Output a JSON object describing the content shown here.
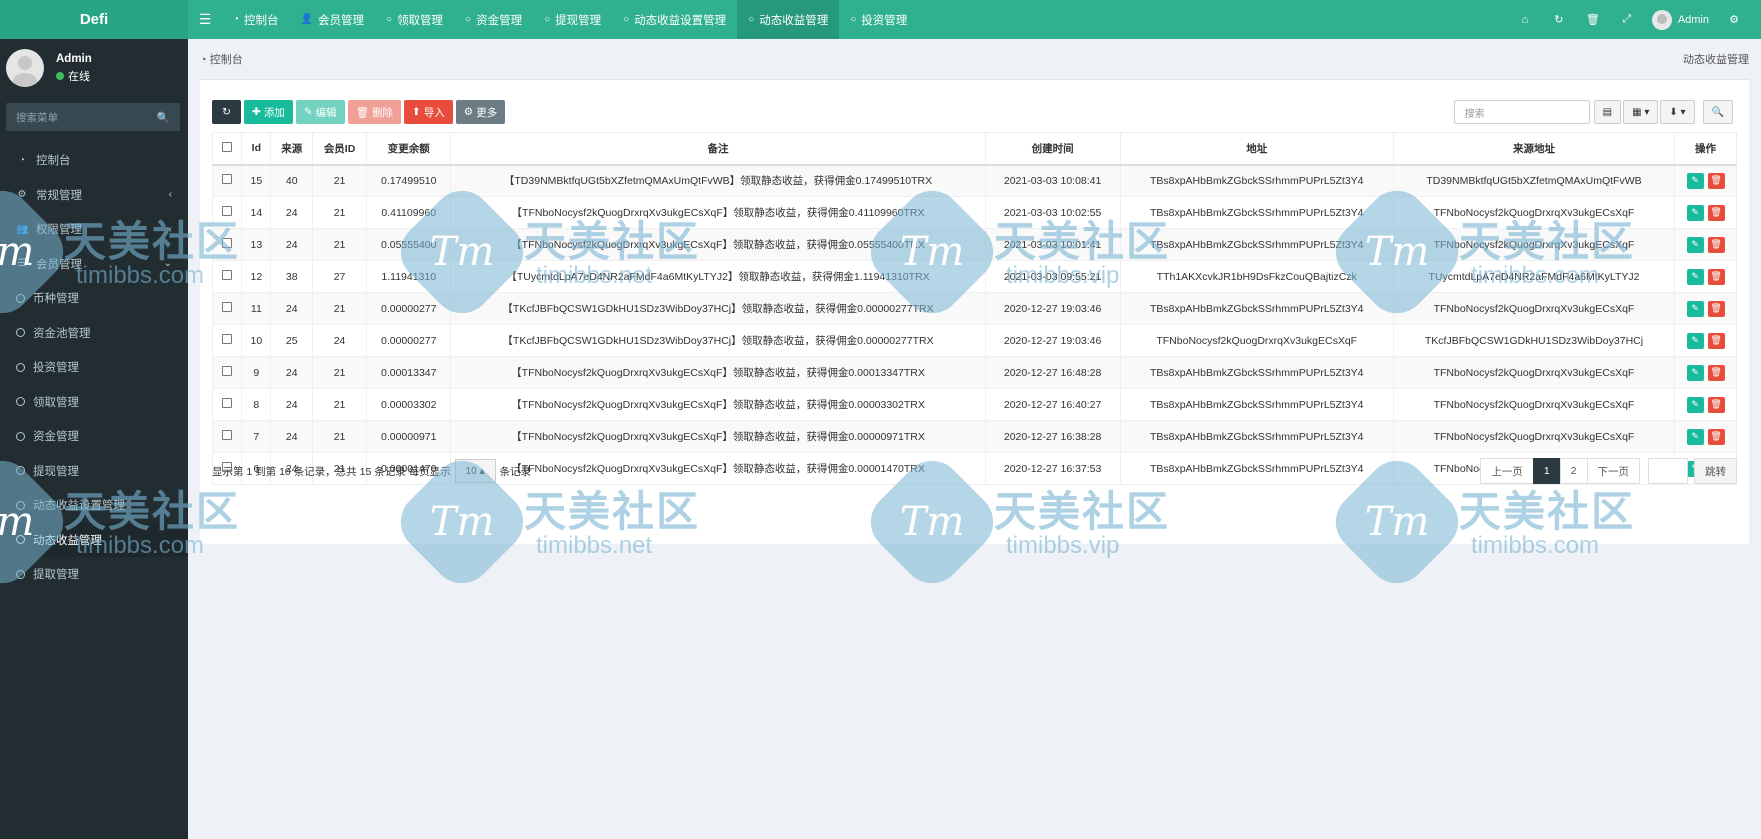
{
  "app": {
    "logo": "Defi"
  },
  "topnav": {
    "tabs": [
      {
        "label": "控制台",
        "icon": "dashboard-icon",
        "active": false
      },
      {
        "label": "会员管理",
        "icon": "user-icon",
        "active": false
      },
      {
        "label": "领取管理",
        "icon": "circle-icon",
        "active": false
      },
      {
        "label": "资金管理",
        "icon": "circle-icon",
        "active": false
      },
      {
        "label": "提现管理",
        "icon": "circle-icon",
        "active": false
      },
      {
        "label": "动态收益设置管理",
        "icon": "circle-icon",
        "active": false
      },
      {
        "label": "动态收益管理",
        "icon": "circle-icon",
        "active": true
      },
      {
        "label": "投资管理",
        "icon": "circle-icon",
        "active": false
      }
    ],
    "user": "Admin"
  },
  "sidebar": {
    "user": {
      "name": "Admin",
      "status": "在线"
    },
    "search_placeholder": "搜索菜单",
    "items": [
      {
        "label": "控制台",
        "icon": "dashboard-icon",
        "chevron": ""
      },
      {
        "label": "常规管理",
        "icon": "cogs-icon",
        "chevron": "‹"
      },
      {
        "label": "权限管理",
        "icon": "group-icon",
        "chevron": "‹"
      },
      {
        "label": "会员管理",
        "icon": "list-icon",
        "chevron": "⌄"
      },
      {
        "label": "币种管理",
        "icon": "circle-icon",
        "chevron": ""
      },
      {
        "label": "资金池管理",
        "icon": "circle-icon",
        "chevron": ""
      },
      {
        "label": "投资管理",
        "icon": "circle-icon",
        "chevron": ""
      },
      {
        "label": "领取管理",
        "icon": "circle-icon",
        "chevron": ""
      },
      {
        "label": "资金管理",
        "icon": "circle-icon",
        "chevron": ""
      },
      {
        "label": "提现管理",
        "icon": "circle-icon",
        "chevron": ""
      },
      {
        "label": "动态收益设置管理",
        "icon": "circle-icon",
        "chevron": ""
      },
      {
        "label": "动态收益管理",
        "icon": "circle-icon",
        "chevron": "",
        "active": true
      },
      {
        "label": "提取管理",
        "icon": "circle-icon",
        "chevron": ""
      }
    ]
  },
  "breadcrumb": {
    "home": "控制台",
    "current": "动态收益管理"
  },
  "toolbar": {
    "refresh": "",
    "add": "添加",
    "edit": "编辑",
    "delete": "删除",
    "import": "导入",
    "more": "更多",
    "search_placeholder": "搜索"
  },
  "table": {
    "headers": [
      "Id",
      "来源",
      "会员ID",
      "变更余额",
      "备注",
      "创建时间",
      "地址",
      "来源地址",
      "操作"
    ],
    "rows": [
      [
        "15",
        "40",
        "21",
        "0.17499510",
        "【TD39NMBktfqUGt5bXZfetmQMAxUmQtFvWB】领取静态收益，获得佣金0.17499510TRX",
        "2021-03-03 10:08:41",
        "TBs8xpAHbBmkZGbckSSrhmmPUPrL5Zt3Y4",
        "TD39NMBktfqUGt5bXZfetmQMAxUmQtFvWB"
      ],
      [
        "14",
        "24",
        "21",
        "0.41109960",
        "【TFNboNocysf2kQuogDrxrqXv3ukgECsXqF】领取静态收益，获得佣金0.41109960TRX",
        "2021-03-03 10:02:55",
        "TBs8xpAHbBmkZGbckSSrhmmPUPrL5Zt3Y4",
        "TFNboNocysf2kQuogDrxrqXv3ukgECsXqF"
      ],
      [
        "13",
        "24",
        "21",
        "0.05555400",
        "【TFNboNocysf2kQuogDrxrqXv3ukgECsXqF】领取静态收益，获得佣金0.05555400TRX",
        "2021-03-03 10:01:41",
        "TBs8xpAHbBmkZGbckSSrhmmPUPrL5Zt3Y4",
        "TFNboNocysf2kQuogDrxrqXv3ukgECsXqF"
      ],
      [
        "12",
        "38",
        "27",
        "1.11941310",
        "【TUycmtdLpA7eD4NR2aFMdF4a6MtKyLTYJ2】领取静态收益，获得佣金1.11941310TRX",
        "2021-03-03 09:55:21",
        "TTh1AKXcvkJR1bH9DsFkzCouQBajtizCzk",
        "TUycmtdLpA7eD4NR2aFMdF4a6MtKyLTYJ2"
      ],
      [
        "11",
        "24",
        "21",
        "0.00000277",
        "【TKcfJBFbQCSW1GDkHU1SDz3WibDoy37HCj】领取静态收益，获得佣金0.00000277TRX",
        "2020-12-27 19:03:46",
        "TBs8xpAHbBmkZGbckSSrhmmPUPrL5Zt3Y4",
        "TFNboNocysf2kQuogDrxrqXv3ukgECsXqF"
      ],
      [
        "10",
        "25",
        "24",
        "0.00000277",
        "【TKcfJBFbQCSW1GDkHU1SDz3WibDoy37HCj】领取静态收益，获得佣金0.00000277TRX",
        "2020-12-27 19:03:46",
        "TFNboNocysf2kQuogDrxrqXv3ukgECsXqF",
        "TKcfJBFbQCSW1GDkHU1SDz3WibDoy37HCj"
      ],
      [
        "9",
        "24",
        "21",
        "0.00013347",
        "【TFNboNocysf2kQuogDrxrqXv3ukgECsXqF】领取静态收益，获得佣金0.00013347TRX",
        "2020-12-27 16:48:28",
        "TBs8xpAHbBmkZGbckSSrhmmPUPrL5Zt3Y4",
        "TFNboNocysf2kQuogDrxrqXv3ukgECsXqF"
      ],
      [
        "8",
        "24",
        "21",
        "0.00003302",
        "【TFNboNocysf2kQuogDrxrqXv3ukgECsXqF】领取静态收益，获得佣金0.00003302TRX",
        "2020-12-27 16:40:27",
        "TBs8xpAHbBmkZGbckSSrhmmPUPrL5Zt3Y4",
        "TFNboNocysf2kQuogDrxrqXv3ukgECsXqF"
      ],
      [
        "7",
        "24",
        "21",
        "0.00000971",
        "【TFNboNocysf2kQuogDrxrqXv3ukgECsXqF】领取静态收益，获得佣金0.00000971TRX",
        "2020-12-27 16:38:28",
        "TBs8xpAHbBmkZGbckSSrhmmPUPrL5Zt3Y4",
        "TFNboNocysf2kQuogDrxrqXv3ukgECsXqF"
      ],
      [
        "6",
        "24",
        "21",
        "0.00001470",
        "【TFNboNocysf2kQuogDrxrqXv3ukgECsXqF】领取静态收益，获得佣金0.00001470TRX",
        "2020-12-27 16:37:53",
        "TBs8xpAHbBmkZGbckSSrhmmPUPrL5Zt3Y4",
        "TFNboNocysf2kQuogDrxrqXv3ukgECsXqF"
      ]
    ]
  },
  "pagination": {
    "info_prefix": "显示第 1 到第 10 条记录，总共 15 条记录 每页显示",
    "page_size": "10",
    "info_suffix": "条记录",
    "prev": "上一页",
    "pages": [
      "1",
      "2"
    ],
    "current": "1",
    "next": "下一页",
    "jump": "跳转"
  },
  "watermark": {
    "cn": "天美社区",
    "urls": [
      "timibbs.com",
      "timibbs.net",
      "timibbs.vip",
      "timibbs.com"
    ],
    "logo": "Tm"
  },
  "colors": {
    "topbar": "#2fb08f",
    "sidebar": "#222d32",
    "primary": "#18bc9c",
    "danger": "#e74c3c",
    "pager_active": "#2c3b41"
  }
}
